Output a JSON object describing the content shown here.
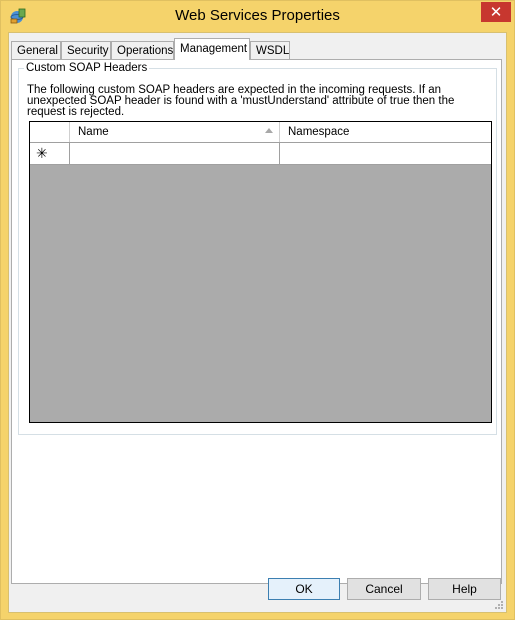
{
  "window": {
    "title": "Web Services Properties",
    "close_glyph": "✕",
    "icon": "web-service-icon"
  },
  "tabs": [
    {
      "label": "General"
    },
    {
      "label": "Security"
    },
    {
      "label": "Operations"
    },
    {
      "label": "Management",
      "active": true
    },
    {
      "label": "WSDL"
    }
  ],
  "group": {
    "label": "Custom SOAP Headers",
    "description": "The following custom SOAP headers are expected in the incoming requests. If an unexpected SOAP header is found with a 'mustUnderstand' attribute of true then the request is rejected."
  },
  "grid": {
    "columns": [
      {
        "label": "Name"
      },
      {
        "label": "Namespace"
      }
    ],
    "new_row_glyph": "✳"
  },
  "buttons": {
    "ok": "OK",
    "cancel": "Cancel",
    "help": "Help"
  },
  "colors": {
    "title_bar": "#f5d36b",
    "close_button": "#c7372f",
    "grid_empty_area": "#ababab"
  }
}
